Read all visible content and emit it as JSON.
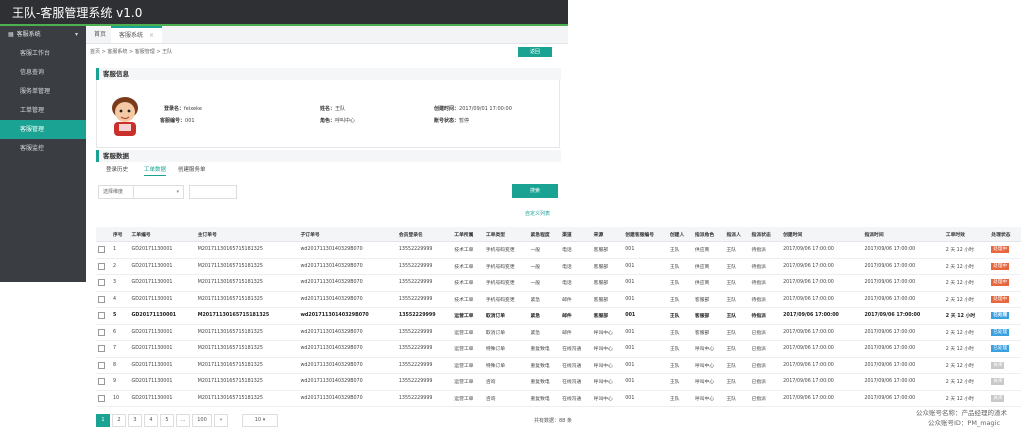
{
  "app": {
    "title": "王队-客服管理系统 v1.0"
  },
  "sidebar": {
    "group": "客服系统",
    "items": [
      {
        "label": "客服工作台"
      },
      {
        "label": "信息查询"
      },
      {
        "label": "服务单管理"
      },
      {
        "label": "工单管理"
      },
      {
        "label": "客服管理"
      },
      {
        "label": "客服监控"
      }
    ]
  },
  "tabs": {
    "home": "首页",
    "current": "客服系统"
  },
  "breadcrumb": "首页 > 客服系统 > 客服管理 > 王队",
  "back_label": "返回",
  "info": {
    "heading": "客服信息",
    "login_name_label": "登录名：",
    "login_name": "feixeke",
    "staff_no_label": "客服编号：",
    "staff_no": "001",
    "name_label": "姓名：",
    "name": "王队",
    "role_label": "角色：",
    "role": "呼叫中心",
    "created_label": "创建时间：",
    "created": "2017/09/01 17:00:00",
    "status_label": "账号状态：",
    "status": "暂停"
  },
  "data_section": {
    "heading": "客服数据",
    "subtabs": [
      "登录历史",
      "工单数据",
      "创建服务单"
    ],
    "filter_label": "选择维度",
    "search_label": "搜索",
    "custom_columns": "自定义列表"
  },
  "table": {
    "headers": [
      "序号",
      "工单编号",
      "主订单号",
      "子订单号",
      "会员登录名",
      "工单所属",
      "工单类型",
      "紧急程度",
      "渠道",
      "来源",
      "创建客服编号",
      "创建人",
      "指派角色",
      "指派人",
      "指派状态",
      "创建时间",
      "指派时间",
      "工单时效",
      "处理状态"
    ],
    "rows": [
      {
        "no": "1",
        "id": "GD20171130001",
        "main": "M20171130165715181325",
        "sub": "wd20171130140329B070",
        "member": "13552229999",
        "belong": "技术工单",
        "type": "手机号码变更",
        "urgency": "一般",
        "channel": "电话",
        "source": "客服部",
        "creator_no": "001",
        "creator": "王队",
        "role": "供应商",
        "assignee": "王队",
        "assign_status": "待指派",
        "created": "2017/09/06 17:00:00",
        "assigned": "2017/09/06 17:00:00",
        "sla": "2 天 12 小时",
        "status": "处理中",
        "status_color": "#e8663d"
      },
      {
        "no": "2",
        "id": "GD20171130001",
        "main": "M20171130165715181325",
        "sub": "wd20171130140329B070",
        "member": "13552229999",
        "belong": "技术工单",
        "type": "手机号码变更",
        "urgency": "一般",
        "channel": "电话",
        "source": "客服部",
        "creator_no": "001",
        "creator": "王队",
        "role": "供应商",
        "assignee": "王队",
        "assign_status": "待指派",
        "created": "2017/09/06 17:00:00",
        "assigned": "2017/09/06 17:00:00",
        "sla": "2 天 12 小时",
        "status": "处理中",
        "status_color": "#e8663d"
      },
      {
        "no": "3",
        "id": "GD20171130001",
        "main": "M20171130165715181325",
        "sub": "wd20171130140329B070",
        "member": "13552229999",
        "belong": "技术工单",
        "type": "手机号码变更",
        "urgency": "一般",
        "channel": "电话",
        "source": "客服部",
        "creator_no": "001",
        "creator": "王队",
        "role": "供应商",
        "assignee": "王队",
        "assign_status": "待指派",
        "created": "2017/09/06 17:00:00",
        "assigned": "2017/09/06 17:00:00",
        "sla": "2 天 12 小时",
        "status": "处理中",
        "status_color": "#e8663d"
      },
      {
        "no": "4",
        "id": "GD20171130001",
        "main": "M20171130165715181325",
        "sub": "wd20171130140329B070",
        "member": "13552229999",
        "belong": "技术工单",
        "type": "手机号码变更",
        "urgency": "紧急",
        "channel": "邮件",
        "source": "客服部",
        "creator_no": "001",
        "creator": "王队",
        "role": "客服部",
        "assignee": "王队",
        "assign_status": "待指派",
        "created": "2017/09/06 17:00:00",
        "assigned": "2017/09/06 17:00:00",
        "sla": "2 天 12 小时",
        "status": "处理中",
        "status_color": "#e8663d"
      },
      {
        "no": "5",
        "id": "GD20171130001",
        "main": "M20171130165715181325",
        "sub": "wd20171130140329B070",
        "member": "13552229999",
        "belong": "运营工单",
        "type": "取消订单",
        "urgency": "紧急",
        "channel": "邮件",
        "source": "客服部",
        "creator_no": "001",
        "creator": "王队",
        "role": "客服部",
        "assignee": "王队",
        "assign_status": "待指派",
        "created": "2017/09/06 17:00:00",
        "assigned": "2017/09/06 17:00:00",
        "sla": "2 天 12 小时",
        "status": "已处理",
        "status_color": "#3ba0e0",
        "bold": true
      },
      {
        "no": "6",
        "id": "GD20171130001",
        "main": "M20171130165715181325",
        "sub": "wd20171130140329B070",
        "member": "13552229999",
        "belong": "运营工单",
        "type": "取消订单",
        "urgency": "紧急",
        "channel": "邮件",
        "source": "呼叫中心",
        "creator_no": "001",
        "creator": "王队",
        "role": "客服部",
        "assignee": "王队",
        "assign_status": "已指派",
        "created": "2017/09/06 17:00:00",
        "assigned": "2017/09/06 17:00:00",
        "sla": "2 天 12 小时",
        "status": "已处理",
        "status_color": "#3ba0e0"
      },
      {
        "no": "7",
        "id": "GD20171130001",
        "main": "M20171130165715181325",
        "sub": "wd20171130140329B070",
        "member": "13552229999",
        "belong": "运营工单",
        "type": "特殊订单",
        "urgency": "重复致电",
        "channel": "在线沟通",
        "source": "呼叫中心",
        "creator_no": "001",
        "creator": "王队",
        "role": "呼叫中心",
        "assignee": "王队",
        "assign_status": "已指派",
        "created": "2017/09/06 17:00:00",
        "assigned": "2017/09/06 17:00:00",
        "sla": "2 天 12 小时",
        "status": "已处理",
        "status_color": "#3ba0e0"
      },
      {
        "no": "8",
        "id": "GD20171130001",
        "main": "M20171130165715181325",
        "sub": "wd20171130140329B070",
        "member": "13552229999",
        "belong": "运营工单",
        "type": "特殊订单",
        "urgency": "重复致电",
        "channel": "在线沟通",
        "source": "呼叫中心",
        "creator_no": "001",
        "creator": "王队",
        "role": "呼叫中心",
        "assignee": "王队",
        "assign_status": "已指派",
        "created": "2017/09/06 17:00:00",
        "assigned": "2017/09/06 17:00:00",
        "sla": "2 天 12 小时",
        "status": "关闭",
        "status_color": "#c8c8c8"
      },
      {
        "no": "9",
        "id": "GD20171130001",
        "main": "M20171130165715181325",
        "sub": "wd20171130140329B070",
        "member": "13552229999",
        "belong": "运营工单",
        "type": "咨询",
        "urgency": "重复致电",
        "channel": "在线沟通",
        "source": "呼叫中心",
        "creator_no": "001",
        "creator": "王队",
        "role": "呼叫中心",
        "assignee": "王队",
        "assign_status": "已指派",
        "created": "2017/09/06 17:00:00",
        "assigned": "2017/09/06 17:00:00",
        "sla": "2 天 12 小时",
        "status": "关闭",
        "status_color": "#c8c8c8"
      },
      {
        "no": "10",
        "id": "GD20171130001",
        "main": "M20171130165715181325",
        "sub": "wd20171130140329B070",
        "member": "13552229999",
        "belong": "运营工单",
        "type": "咨询",
        "urgency": "重复致电",
        "channel": "在线沟通",
        "source": "呼叫中心",
        "creator_no": "001",
        "creator": "王队",
        "role": "呼叫中心",
        "assignee": "王队",
        "assign_status": "已指派",
        "created": "2017/09/06 17:00:00",
        "assigned": "2017/09/06 17:00:00",
        "sla": "2 天 12 小时",
        "status": "关闭",
        "status_color": "#c8c8c8"
      }
    ]
  },
  "pagination": {
    "pages": [
      "1",
      "2",
      "3",
      "4",
      "5",
      "...",
      "100",
      "»"
    ],
    "page_size": "10",
    "total": "共有数据：88 条"
  },
  "watermark": {
    "line1": "公众账号名称：产品经理的渣术",
    "line2": "公众账号ID：PM_magic"
  },
  "colors": {
    "accent": "#1aa393",
    "sidebar": "#3a3d42",
    "topbar": "#2f3033"
  }
}
